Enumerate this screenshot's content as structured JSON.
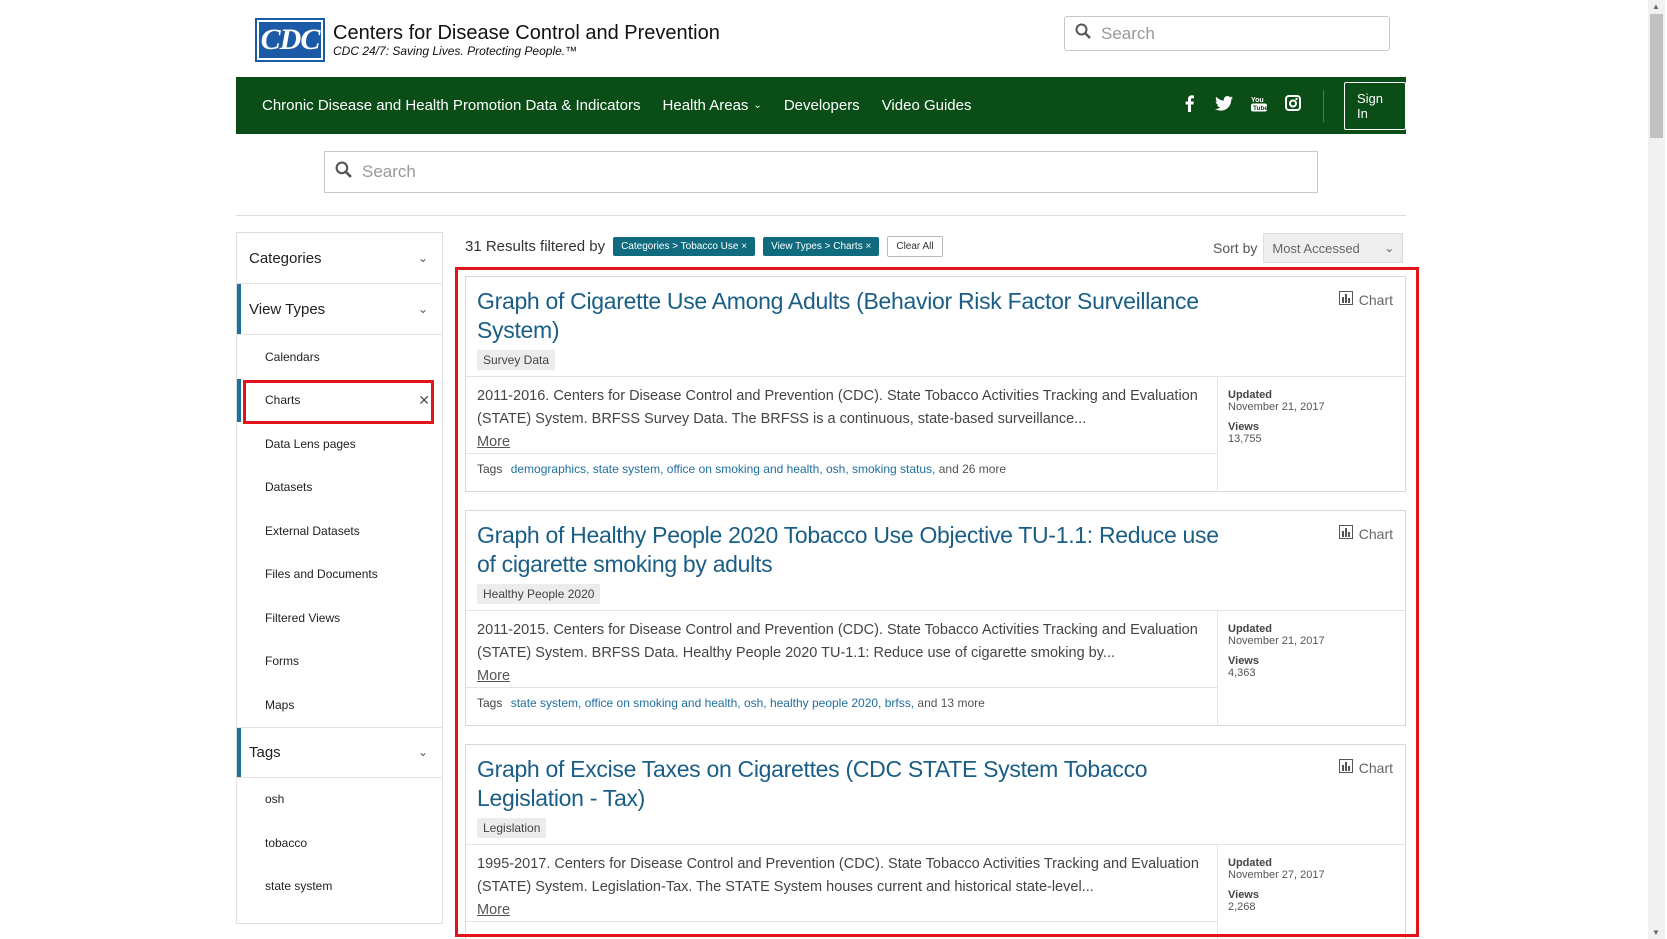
{
  "header": {
    "logo_text": "CDC",
    "title": "Centers for Disease Control and Prevention",
    "subtitle": "CDC 24/7: Saving Lives. Protecting People.™",
    "search_placeholder": "Search"
  },
  "nav": {
    "items": [
      "Chronic Disease and Health Promotion Data & Indicators",
      "Health Areas",
      "Developers",
      "Video Guides"
    ],
    "social": [
      "f",
      "t",
      "yt",
      "ig"
    ],
    "signin_label": "Sign In"
  },
  "main_search": {
    "placeholder": "Search"
  },
  "sidebar": {
    "categories_label": "Categories",
    "view_types_label": "View Types",
    "view_types": [
      "Calendars",
      "Charts",
      "Data Lens pages",
      "Datasets",
      "External Datasets",
      "Files and Documents",
      "Filtered Views",
      "Forms",
      "Maps"
    ],
    "selected_view_type": "Charts",
    "tags_label": "Tags",
    "tags": [
      "osh",
      "tobacco",
      "state system"
    ]
  },
  "results_header": {
    "count_text": "31 Results filtered by",
    "chips": [
      "Categories > Tobacco Use",
      "View Types > Charts"
    ],
    "clear_all": "Clear All",
    "sort_label": "Sort by",
    "sort_value": "Most Accessed"
  },
  "results": [
    {
      "title": "Graph of Cigarette Use Among Adults (Behavior Risk Factor Surveillance System)",
      "badge": "Survey Data",
      "type": "Chart",
      "description": "2011-2016. Centers for Disease Control and Prevention (CDC). State Tobacco Activities Tracking and Evaluation (STATE) System. BRFSS Survey Data. The BRFSS is a continuous, state-based surveillance...",
      "more": "More",
      "tags_label": "Tags",
      "tags": "demographics, state system, office on smoking and health, osh, smoking status,",
      "tags_more": "and 26 more",
      "updated_label": "Updated",
      "updated": "November 21, 2017",
      "views_label": "Views",
      "views": "13,755"
    },
    {
      "title": "Graph of Healthy People 2020 Tobacco Use Objective TU-1.1: Reduce use of cigarette smoking by adults",
      "badge": "Healthy People 2020",
      "type": "Chart",
      "description": "2011-2015. Centers for Disease Control and Prevention (CDC). State Tobacco Activities Tracking and Evaluation (STATE) System. BRFSS Data. Healthy People 2020 TU-1.1: Reduce use of cigarette smoking by...",
      "more": "More",
      "tags_label": "Tags",
      "tags": "state system, office on smoking and health, osh, healthy people 2020, brfss,",
      "tags_more": "and 13 more",
      "updated_label": "Updated",
      "updated": "November 21, 2017",
      "views_label": "Views",
      "views": "4,363"
    },
    {
      "title": "Graph of Excise Taxes on Cigarettes (CDC STATE System Tobacco Legislation - Tax)",
      "badge": "Legislation",
      "type": "Chart",
      "description": "1995-2017. Centers for Disease Control and Prevention (CDC). State Tobacco Activities Tracking and Evaluation (STATE) System. Legislation-Tax. The STATE System houses current and historical state-level...",
      "more": "More",
      "tags_label": "Tags",
      "tags": "",
      "tags_more": "",
      "updated_label": "Updated",
      "updated": "November 27, 2017",
      "views_label": "Views",
      "views": "2,268"
    }
  ]
}
